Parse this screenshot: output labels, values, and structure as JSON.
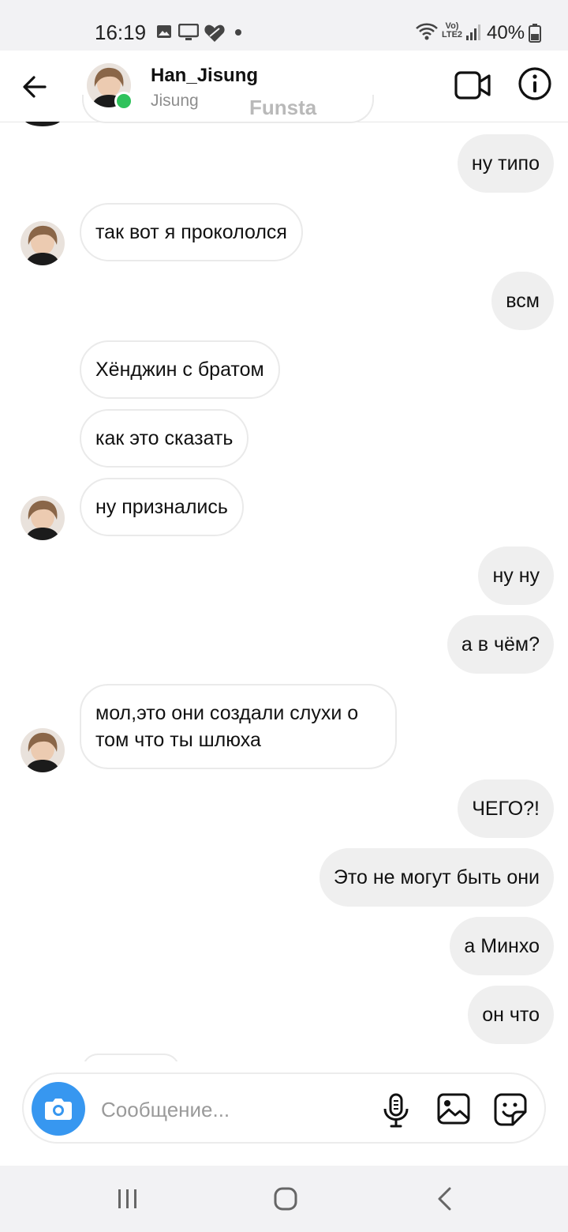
{
  "status_bar": {
    "time": "16:19",
    "network": "Vo) LTE2",
    "battery": "40%"
  },
  "header": {
    "username": "Han_Jisung",
    "subtitle": "Jisung",
    "tag": "Funsta",
    "online_color": "#2fc25b",
    "icons": [
      "back-arrow-icon",
      "video-call-icon",
      "info-icon"
    ]
  },
  "messages": [
    {
      "side": "out",
      "text": "ну типо"
    },
    {
      "side": "in",
      "text": "так вот я прокололся",
      "avatar": true
    },
    {
      "side": "out",
      "text": "всм"
    },
    {
      "side": "in",
      "text": "Хёнджин с братом"
    },
    {
      "side": "in",
      "text": "как это сказать"
    },
    {
      "side": "in",
      "text": "ну признались",
      "avatar": true
    },
    {
      "side": "out",
      "text": "ну ну"
    },
    {
      "side": "out",
      "text": "а в чём?"
    },
    {
      "side": "in",
      "text": "мол,это они создали слухи о том что ты шлюха",
      "avatar": true
    },
    {
      "side": "out",
      "text": "ЧЕГО?!"
    },
    {
      "side": "out",
      "text": "Это не могут быть они"
    },
    {
      "side": "out",
      "text": "а Минхо"
    },
    {
      "side": "out",
      "text": "он что"
    }
  ],
  "composer": {
    "placeholder": "Сообщение...",
    "value": "",
    "accent": "#3797f0",
    "icons": [
      "camera-icon",
      "microphone-icon",
      "gallery-icon",
      "sticker-icon"
    ]
  },
  "nav_bar": {
    "icons": [
      "recent-apps-icon",
      "home-icon",
      "back-icon"
    ]
  }
}
